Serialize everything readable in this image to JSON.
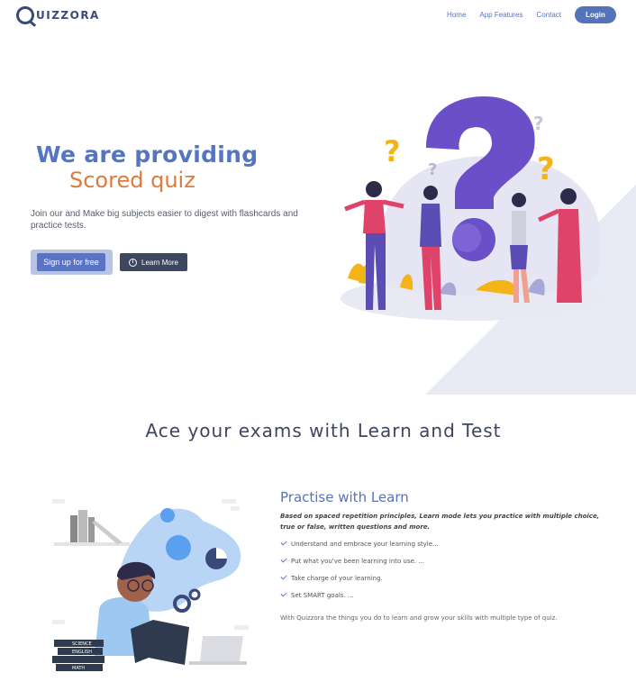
{
  "nav": {
    "logo": "UIZZORA",
    "links": [
      "Home",
      "App Features",
      "Contact"
    ],
    "login": "Login"
  },
  "hero": {
    "title": "We are providing",
    "subtitle": "Scored quiz",
    "description": "Join our and Make big subjects easier to digest with flashcards and practice tests.",
    "signup_label": "Sign up for free",
    "learn_more_label": "Learn More"
  },
  "section": {
    "title": "Ace your exams with Learn and Test"
  },
  "learn": {
    "title": "Practise with Learn",
    "description": "Based on spaced repetition principles, Learn mode lets you practice with multiple choice, true or false, written questions and more.",
    "bullets": [
      "Understand and embrace your learning style...",
      "Put what you've been learning into use. ...",
      "Take charge of your learning.",
      "Set SMART goals. ..."
    ],
    "footer": "With Quizzora the things you do to learn and grow your skills with multiple type of quiz.",
    "book_labels": [
      "SCIENCE",
      "ENGLISH",
      "MATH"
    ]
  },
  "colors": {
    "brand": "#5573b8",
    "accent_orange": "#e07a3c",
    "dark_button": "#3d4760",
    "question_purple": "#6a4fc8",
    "question_yellow": "#f2b417"
  }
}
